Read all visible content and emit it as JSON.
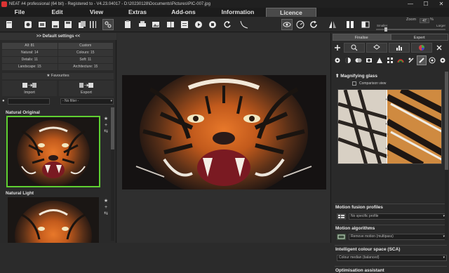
{
  "window": {
    "title": "NEAT #4 professional (64 bit) - Registered to - V4.23.04017 - D:\\20230128\\Documents\\Pictures\\PIC-007.jpg",
    "minimize": "—",
    "maximize": "☐",
    "close": "✕"
  },
  "menu": [
    "File",
    "Edit",
    "View",
    "Extras",
    "Add-ons",
    "Information",
    "Licence"
  ],
  "zoom": {
    "label": "Zoom",
    "value": "47",
    "unit": "%",
    "smaller": "Smaller",
    "larger": "Larger",
    "level": 0.14
  },
  "left": {
    "header": ">> Default settings <<",
    "filters": [
      [
        "All: 81",
        "Custom"
      ],
      [
        "Natural: 14",
        "Colours: 15"
      ],
      [
        "Details: 11",
        "Soft: 11"
      ],
      [
        "Landscape: 15",
        "Architecture: 15"
      ]
    ],
    "favourites": "Favourites",
    "import": "Import",
    "export": "Export",
    "filter_select": "- No filter -",
    "presets": [
      "Natural Original",
      "Natural Light"
    ]
  },
  "right": {
    "tabs": [
      "Finalise",
      "Expert"
    ],
    "magnifier_title": "Magnifying glass",
    "comparison": "Comparison view",
    "motion_fusion_title": "Motion fusion profiles",
    "motion_fusion_value": "No specific profile",
    "motion_algo_title": "Motion algorithms",
    "motion_algo_value": "Remove motion (multipass)",
    "sca_title": "Intelligent colour space (SCA)",
    "sca_value": "Colour median (balanced)",
    "opt_title": "Optimisation assistant"
  }
}
